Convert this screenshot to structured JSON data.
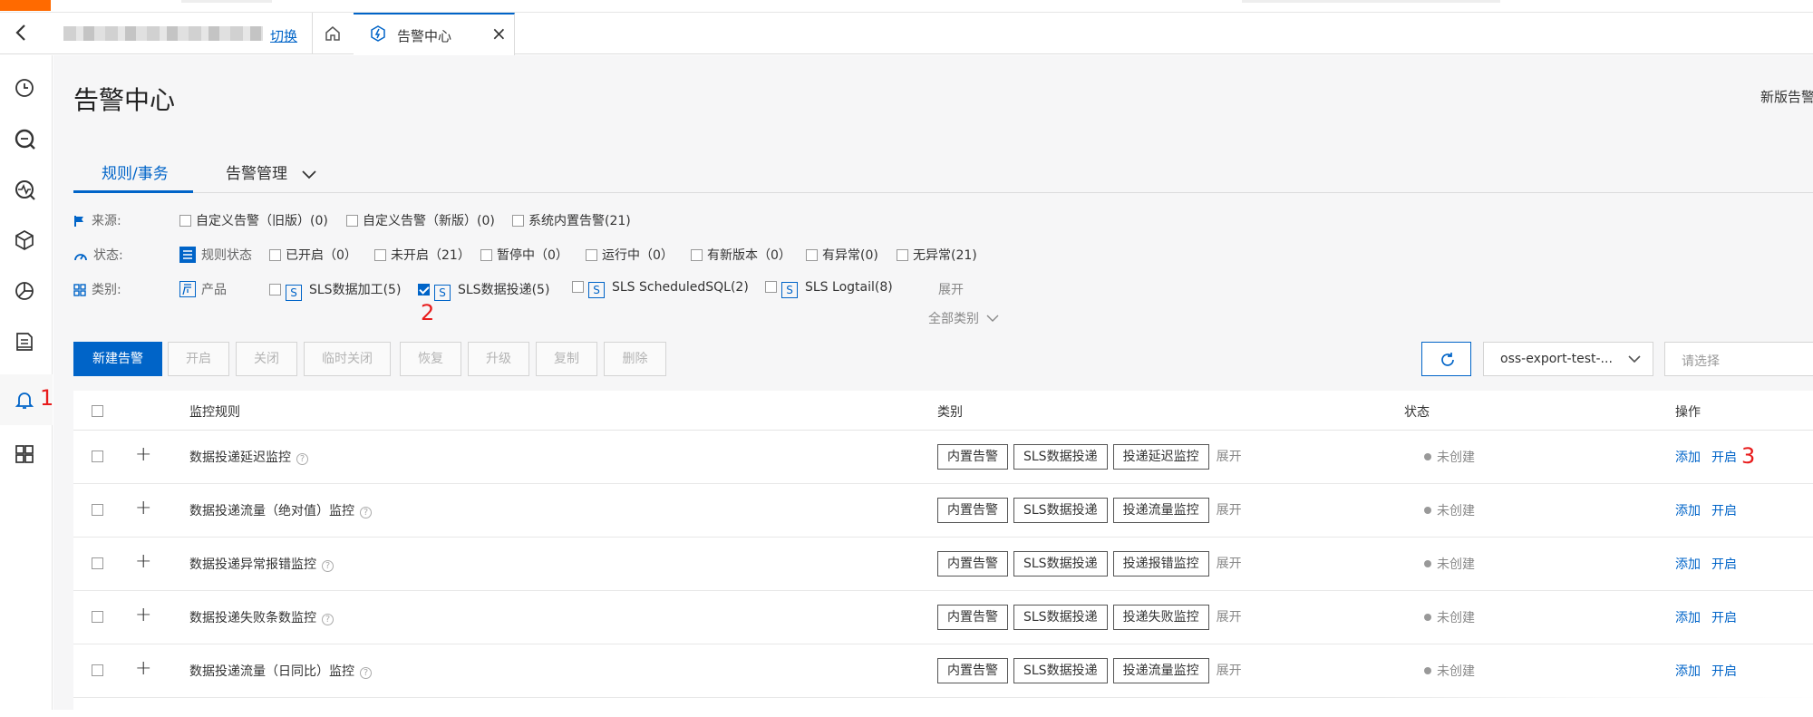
{
  "tabbar": {
    "switch_label": "切换",
    "current_tab": "告警中心"
  },
  "page": {
    "title": "告警中心",
    "new_version_label": "新版告警"
  },
  "tabs": {
    "rules": "规则/事务",
    "alert_mgmt": "告警管理"
  },
  "filters": {
    "source": {
      "label": "来源:",
      "options": [
        "自定义告警（旧版）(0)",
        "自定义告警（新版）(0)",
        "系统内置告警(21)"
      ]
    },
    "status": {
      "label": "状态:",
      "group": "规则状态",
      "options": [
        "已开启（0）",
        "未开启（21）",
        "暂停中（0）",
        "运行中（0）",
        "有新版本（0）",
        "有异常(0)",
        "无异常(21)"
      ]
    },
    "category": {
      "label": "类别:",
      "group": "产品",
      "options": [
        "SLS数据加工(5)",
        "SLS数据投递(5)",
        "SLS ScheduledSQL(2)",
        "SLS Logtail(8)"
      ],
      "checked_index": 1,
      "expand": "展开",
      "all_categories": "全部类别"
    }
  },
  "annotations": {
    "m1": "1",
    "m2": "2",
    "m3": "3"
  },
  "toolbar": {
    "new_alert": "新建告警",
    "enable": "开启",
    "close": "关闭",
    "temp_close": "临时关闭",
    "restore": "恢复",
    "upgrade": "升级",
    "copy": "复制",
    "delete": "删除",
    "project_select": "oss-export-test-...",
    "placeholder": "请选择"
  },
  "table": {
    "headers": {
      "rule": "监控规则",
      "category": "类别",
      "status": "状态",
      "actions": "操作"
    },
    "rows": [
      {
        "name": "数据投递延迟监控",
        "tags": [
          "内置告警",
          "SLS数据投递",
          "投递延迟监控"
        ],
        "status": "未创建",
        "add": "添加",
        "enable": "开启"
      },
      {
        "name": "数据投递流量（绝对值）监控",
        "tags": [
          "内置告警",
          "SLS数据投递",
          "投递流量监控"
        ],
        "status": "未创建",
        "add": "添加",
        "enable": "开启"
      },
      {
        "name": "数据投递异常报错监控",
        "tags": [
          "内置告警",
          "SLS数据投递",
          "投递报错监控"
        ],
        "status": "未创建",
        "add": "添加",
        "enable": "开启"
      },
      {
        "name": "数据投递失败条数监控",
        "tags": [
          "内置告警",
          "SLS数据投递",
          "投递失败监控"
        ],
        "status": "未创建",
        "add": "添加",
        "enable": "开启"
      },
      {
        "name": "数据投递流量（日同比）监控",
        "tags": [
          "内置告警",
          "SLS数据投递",
          "投递流量监控"
        ],
        "status": "未创建",
        "add": "添加",
        "enable": "开启"
      }
    ],
    "expand": "展开"
  },
  "colors": {
    "primary": "#0064c8",
    "mark": "#e81b1b",
    "brand": "#ff6a00"
  }
}
